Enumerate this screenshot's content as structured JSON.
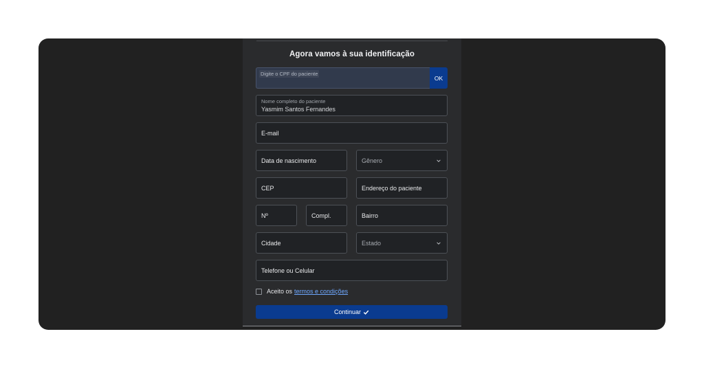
{
  "form": {
    "title": "Agora vamos à sua identificação",
    "cpf": {
      "placeholder": "Digite o CPF do paciente",
      "button_label": "OK"
    },
    "name": {
      "label": "Nome completo do paciente",
      "value": "Yasmim Santos Fernandes"
    },
    "email": {
      "placeholder": "E-mail"
    },
    "birth_date": {
      "placeholder": "Data de nascimento"
    },
    "gender": {
      "selected": "Gênero",
      "icon": "chevron-down-icon"
    },
    "cep": {
      "placeholder": "CEP"
    },
    "address": {
      "placeholder": "Endereço do paciente"
    },
    "number": {
      "placeholder": "Nº"
    },
    "complement": {
      "placeholder": "Compl."
    },
    "neighborhood": {
      "placeholder": "Bairro"
    },
    "city": {
      "placeholder": "Cidade"
    },
    "state": {
      "selected": "Estado",
      "icon": "chevron-down-icon"
    },
    "phone": {
      "placeholder": "Telefone ou Celular"
    },
    "terms": {
      "prefix": "Aceito os",
      "link": "termos e condições",
      "checked": false
    },
    "submit": {
      "label": "Continuar",
      "icon": "check-icon"
    }
  },
  "colors": {
    "background": "#212121",
    "panel": "#2a2b2d",
    "field": "#202225",
    "accent": "#0a3b8f",
    "link": "#6ea8ff"
  }
}
